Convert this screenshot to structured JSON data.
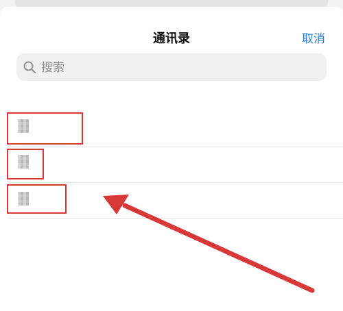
{
  "header": {
    "title": "通讯录",
    "cancel_label": "取消"
  },
  "search": {
    "placeholder": "搜索",
    "value": ""
  },
  "contacts": [
    {
      "name": ""
    },
    {
      "name": ""
    },
    {
      "name": ""
    }
  ],
  "annotation": {
    "color": "#d73838"
  },
  "colors": {
    "accent": "#2f7fd6"
  }
}
